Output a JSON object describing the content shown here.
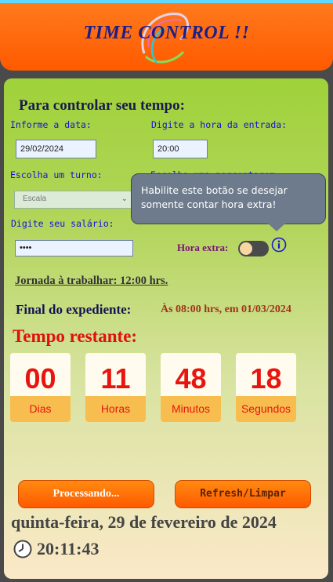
{
  "header": {
    "title": "TIME CONTROL !!"
  },
  "form": {
    "heading": "Para controlar seu tempo:",
    "date_label": "Informe a data:",
    "date_value": "29/02/2024",
    "entry_label": "Digite a hora da entrada:",
    "entry_value": "20:00",
    "shift_label": "Escolha um turno:",
    "shift_selected": "Escala",
    "percent_label": "Escolha uma porcentagem:",
    "salary_label": "Digite seu salário:",
    "salary_value": "••••",
    "extra_label": "Hora extra:",
    "extra_enabled": false,
    "tooltip": "Habilite este botão se desejar somente contar hora extra!"
  },
  "summary": {
    "jornada": "Jornada à trabalhar: 12:00 hrs.",
    "final_label": "Final do expediente:",
    "final_value": "Às 08:00 hrs, em 01/03/2024",
    "restante_label": "Tempo restante:"
  },
  "countdown": [
    {
      "value": "00",
      "unit": "Dias"
    },
    {
      "value": "11",
      "unit": "Horas"
    },
    {
      "value": "48",
      "unit": "Minutos"
    },
    {
      "value": "18",
      "unit": "Segundos"
    }
  ],
  "buttons": {
    "process": "Processando...",
    "refresh": "Refresh/Limpar"
  },
  "footer": {
    "date": "quinta-feira, 29 de fevereiro de 2024",
    "time": "20:11:43"
  },
  "colors": {
    "header": "#ff5a00",
    "accent_red": "#e8150f",
    "unit_bg": "#f7bd4f"
  }
}
